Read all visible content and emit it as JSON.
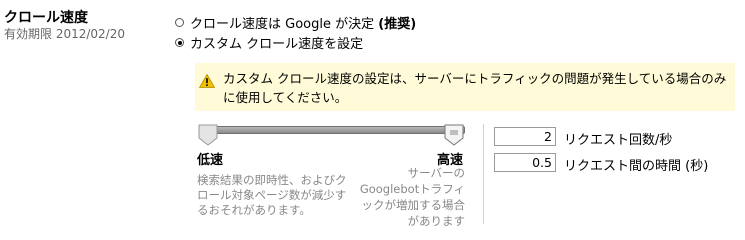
{
  "section": {
    "title": "クロール速度",
    "expiry": "有効期限 2012/02/20"
  },
  "options": {
    "google_label": "クロール速度は Google が決定",
    "google_recommended": "(推奨)",
    "custom_label": "カスタム クロール速度を設定",
    "selected": "custom"
  },
  "warning": {
    "icon": "warning-icon",
    "text": "カスタム クロール速度の設定は、サーバーにトラフィックの問題が発生している場合のみに使用してください。"
  },
  "slider": {
    "value": 1.0,
    "low_label": "低速",
    "high_label": "高速",
    "low_desc": "検索結果の即時性、およびクロール対象ページ数が減少するおそれがあります。",
    "high_desc": "サーバーの Googlebotトラフィックが増加する場合があります"
  },
  "fields": {
    "requests_per_second_value": "2",
    "requests_per_second_label": "リクエスト回数/秒",
    "seconds_between_value": "0.5",
    "seconds_between_label": "リクエスト間の時間 (秒)"
  },
  "colors": {
    "warning_bg": "#fffbd8",
    "warning_icon": "#f2c200",
    "muted_text": "#888888"
  }
}
